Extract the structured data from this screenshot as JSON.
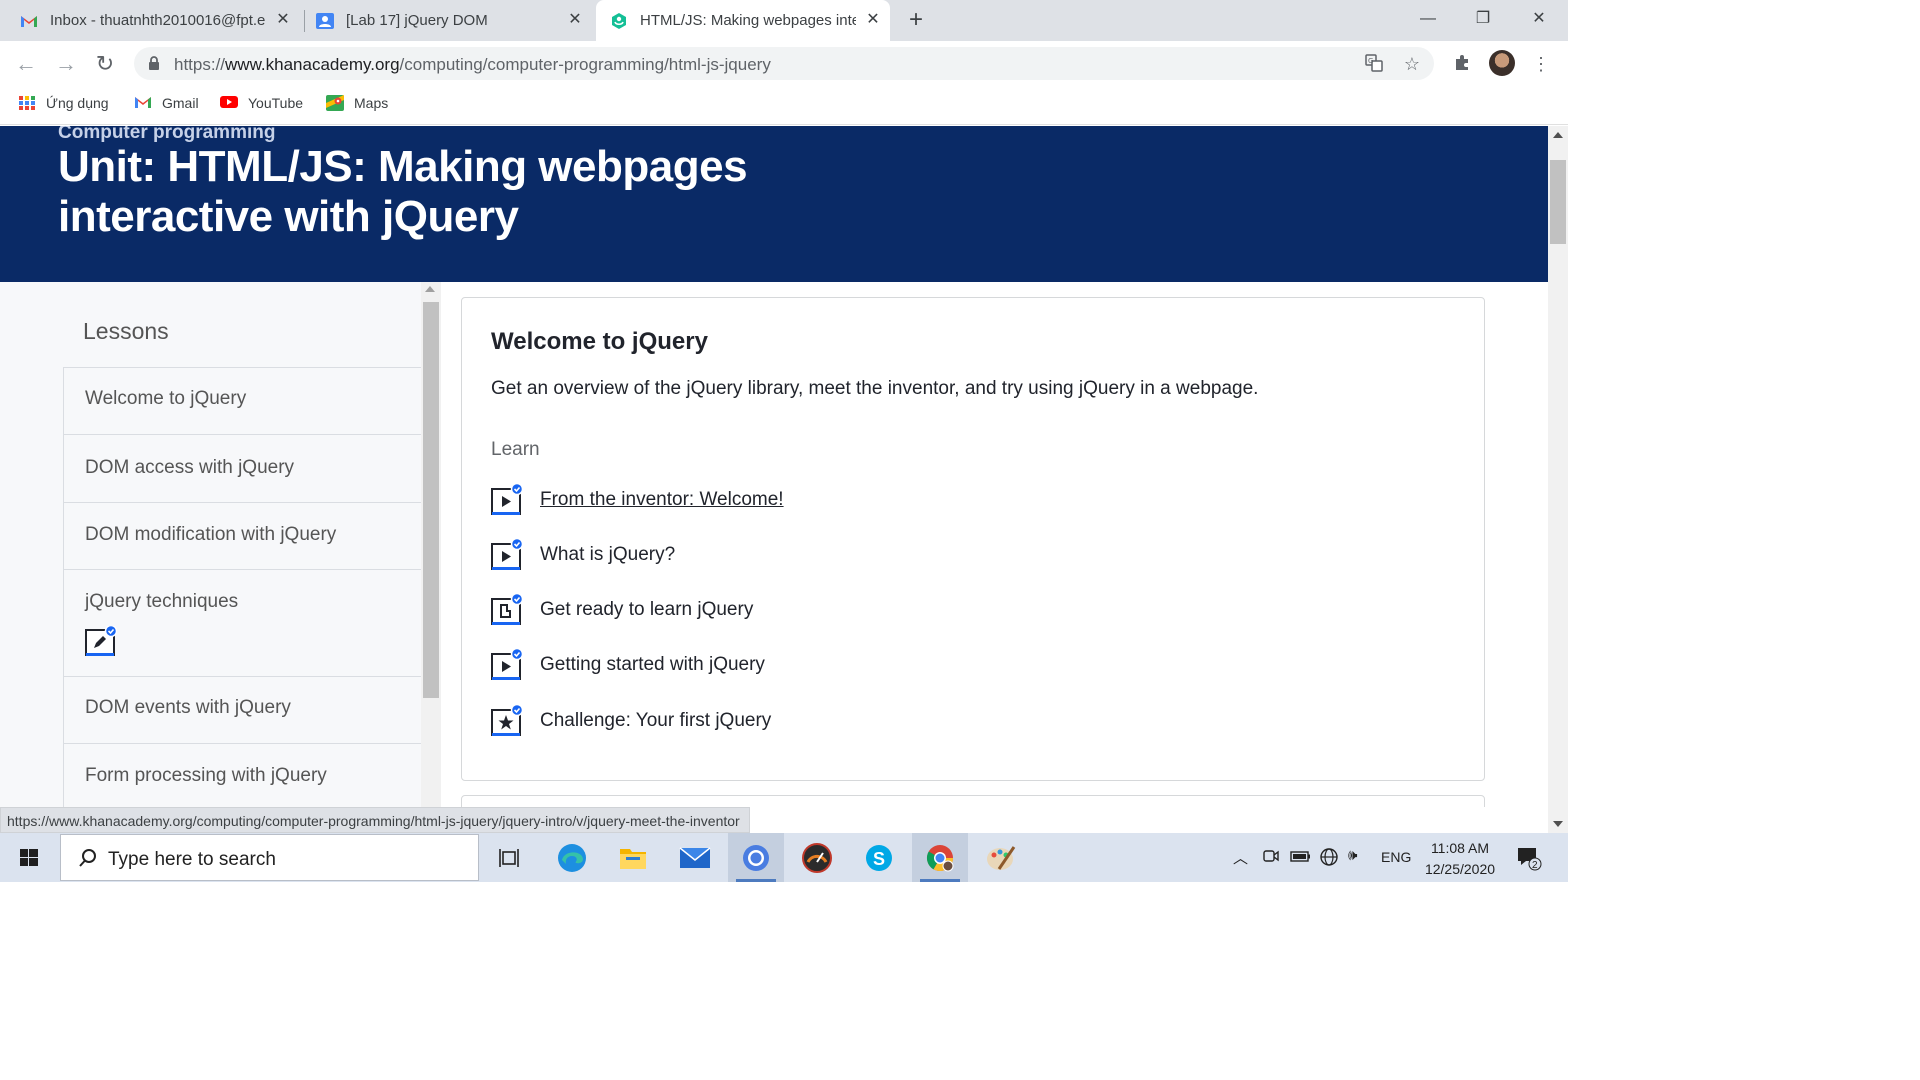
{
  "browser": {
    "tabs": [
      {
        "title": "Inbox - thuatnhth2010016@fpt.e",
        "favicon": "gmail-icon"
      },
      {
        "title": "[Lab 17] jQuery DOM",
        "favicon": "classroom-icon"
      },
      {
        "title": "HTML/JS: Making webpages inte",
        "favicon": "khan-academy-icon",
        "active": true
      }
    ],
    "url_scheme": "https://",
    "url_host": "www.khanacademy.org",
    "url_path": "/computing/computer-programming/html-js-jquery",
    "bookmarks": [
      {
        "label": "Ứng dụng",
        "icon": "apps-grid-icon"
      },
      {
        "label": "Gmail",
        "icon": "gmail-icon"
      },
      {
        "label": "YouTube",
        "icon": "youtube-icon"
      },
      {
        "label": "Maps",
        "icon": "maps-icon"
      }
    ],
    "status_url": "https://www.khanacademy.org/computing/computer-programming/html-js-jquery/jquery-intro/v/jquery-meet-the-inventor"
  },
  "page": {
    "breadcrumb": "Computer programming",
    "title": "Unit: HTML/JS: Making webpages interactive with jQuery",
    "colors": {
      "banner": "#0a2a66",
      "accent": "#1865f2"
    },
    "sidebar": {
      "heading": "Lessons",
      "lessons": [
        {
          "label": "Welcome to jQuery"
        },
        {
          "label": "DOM access with jQuery"
        },
        {
          "label": "DOM modification with jQuery"
        },
        {
          "label": "jQuery techniques",
          "icon": "pencil-exercise-icon",
          "completed": true
        },
        {
          "label": "DOM events with jQuery"
        },
        {
          "label": "Form processing with jQuery"
        }
      ]
    },
    "lesson_card": {
      "title": "Welcome to jQuery",
      "description": "Get an overview of the jQuery library, meet the inventor, and try using jQuery in a webpage.",
      "section_label": "Learn",
      "items": [
        {
          "label": "From the inventor: Welcome!",
          "type": "video",
          "completed": true
        },
        {
          "label": "What is jQuery?",
          "type": "video",
          "completed": true
        },
        {
          "label": "Get ready to learn jQuery",
          "type": "article",
          "completed": true
        },
        {
          "label": "Getting started with jQuery",
          "type": "video",
          "completed": true
        },
        {
          "label": "Challenge: Your first jQuery",
          "type": "challenge",
          "completed": true
        }
      ]
    }
  },
  "taskbar": {
    "search_placeholder": "Type here to search",
    "apps": [
      "task-view-icon",
      "edge-icon",
      "file-explorer-icon",
      "mail-icon",
      "chromium-icon",
      "speedometer-app-icon",
      "skype-icon",
      "chrome-icon",
      "paint-icon"
    ],
    "language": "ENG",
    "time": "11:08 AM",
    "date": "12/25/2020",
    "notification_count": "2"
  }
}
